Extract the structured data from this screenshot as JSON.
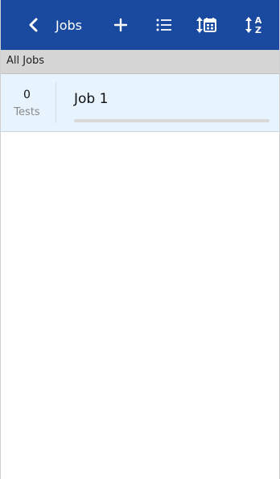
{
  "appbar": {
    "title": "Jobs",
    "icons": [
      "back-chevron-icon",
      "add-icon",
      "list-icon",
      "sort-by-date-icon",
      "sort-alphabetical-icon"
    ],
    "sort_az_glyph_top": "A",
    "sort_az_glyph_bottom": "Z",
    "background": "#1a4aa0"
  },
  "section": {
    "title": "All Jobs"
  },
  "jobs": [
    {
      "name": "Job 1",
      "test_count": "0",
      "test_label": "Tests",
      "progress": 0
    }
  ]
}
